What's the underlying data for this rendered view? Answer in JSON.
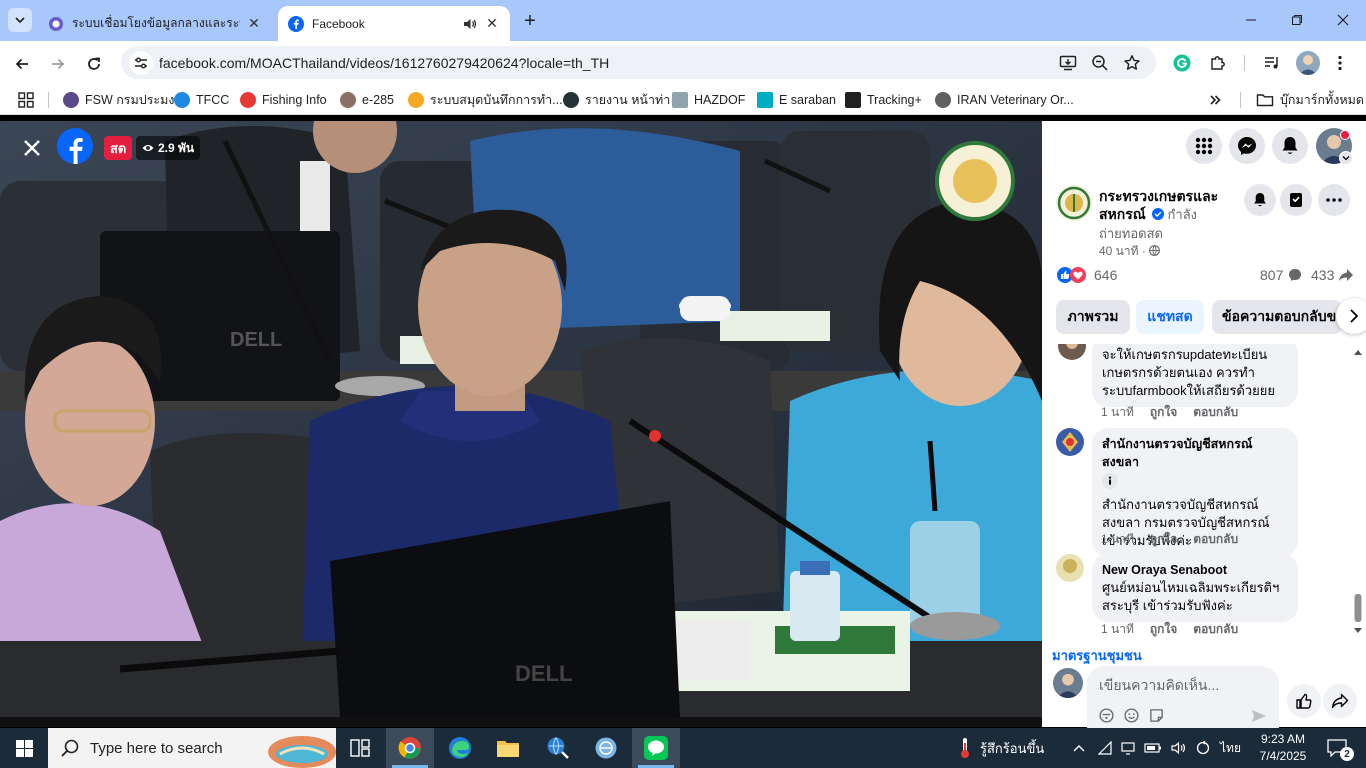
{
  "browser": {
    "tabs": [
      {
        "title": "ระบบเชื่อมโยงข้อมูลกลางและระบบสนับสนุน",
        "active": false
      },
      {
        "title": "Facebook",
        "active": true
      }
    ],
    "url": "facebook.com/MOACThailand/videos/1612760279420624?locale=th_TH",
    "bookmarks": [
      {
        "label": "FSW กรมประมง",
        "icon_color": "#5a4a8a"
      },
      {
        "label": "TFCC",
        "icon_color": "#1e88e5"
      },
      {
        "label": "Fishing Info",
        "icon_color": "#e53935"
      },
      {
        "label": "e-285",
        "icon_color": "#8d6e63"
      },
      {
        "label": "ระบบสมุดบันทึกการทำ...",
        "icon_color": "#f9a825"
      },
      {
        "label": "รายงาน หน้าท่า",
        "icon_color": "#263238"
      },
      {
        "label": "HAZDOF",
        "icon_color": "#90a4ae"
      },
      {
        "label": "E saraban",
        "icon_color": "#00acc1"
      },
      {
        "label": "Tracking+",
        "icon_color": "#212121"
      },
      {
        "label": "IRAN Veterinary Or...",
        "icon_color": "#616161"
      }
    ],
    "bookmarks_folder": "บุ๊กมาร์กทั้งหมด"
  },
  "video": {
    "live_badge": "สด",
    "viewers": "2.9 พัน"
  },
  "panel": {
    "page_name": "กระทรวงเกษตรและสหกรณ์",
    "status_inline": "กำลัง",
    "status_line2": "ถ่ายทอดสด",
    "time": "40 นาที ·",
    "reactions_count": "646",
    "comments_count": "807",
    "shares_count": "433",
    "tabs": [
      {
        "label": "ภาพรวม",
        "active": false
      },
      {
        "label": "แชทสด",
        "active": true
      },
      {
        "label": "ข้อความตอบกลับข",
        "active": false
      }
    ],
    "comments": [
      {
        "name": "",
        "text": "จะให้เกษตรกรupdateทะเบียนเกษตรกรด้วยตนเอง ควรทำระบบfarmbookให้เสถียรด้วยยย",
        "time": "1 นาที",
        "like": "ถูกใจ",
        "reply": "ตอบกลับ"
      },
      {
        "name": "สำนักงานตรวจบัญชีสหกรณ์สงขลา",
        "text": "สำนักงานตรวจบัญชีสหกรณ์สงขลา กรมตรวจบัญชีสหกรณ์ เข้าร่วมรับฟังค่ะ",
        "time": "1 นาที",
        "like": "ถูกใจ",
        "reply": "ตอบกลับ"
      },
      {
        "name": "New Oraya Senaboot",
        "text": "ศูนย์หม่อนไหมเฉลิมพระเกียรติฯ สระบุรี เข้าร่วมรับฟังค่ะ",
        "time": "1 นาที",
        "like": "ถูกใจ",
        "reply": "ตอบกลับ"
      }
    ],
    "community_standards": "มาตรฐานชุมชน",
    "comment_placeholder": "เขียนความคิดเห็น..."
  },
  "taskbar": {
    "search_placeholder": "Type here to search",
    "weather": "รู้สึกร้อนขึ้น",
    "language": "ไทย",
    "time": "9:23 AM",
    "date": "7/4/2025",
    "notifications": "2"
  }
}
